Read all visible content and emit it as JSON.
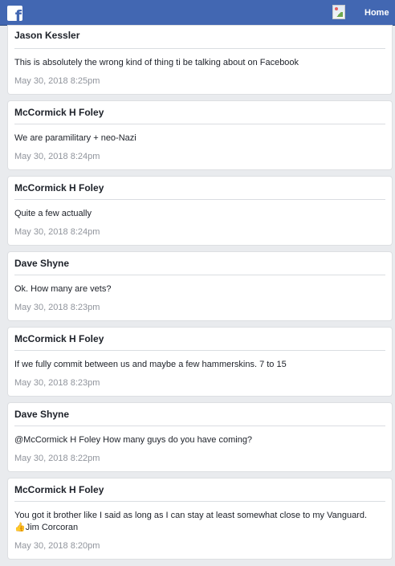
{
  "header": {
    "logo_letter": "f",
    "home_label": "Home"
  },
  "posts": [
    {
      "author": "Jason Kessler",
      "text": "This is absolutely the wrong kind of thing ti be talking about on Facebook",
      "time": "May 30, 2018 8:25pm"
    },
    {
      "author": "McCormick H Foley",
      "text": "We are paramilitary + neo-Nazi",
      "time": "May 30, 2018 8:24pm"
    },
    {
      "author": "McCormick H Foley",
      "text": "Quite a few actually",
      "time": "May 30, 2018 8:24pm"
    },
    {
      "author": "Dave Shyne",
      "text": "Ok. How many are vets?",
      "time": "May 30, 2018 8:23pm"
    },
    {
      "author": "McCormick H Foley",
      "text": "If we fully commit between us and maybe a few hammerskins. 7 to 15",
      "time": "May 30, 2018 8:23pm"
    },
    {
      "author": "Dave Shyne",
      "text": "@McCormick H Foley How many guys do you have coming?",
      "time": "May 30, 2018 8:22pm"
    },
    {
      "author": "McCormick H Foley",
      "text": "You got it brother like I said as long as I can stay at least somewhat close to my Vanguard.",
      "reaction": "👍Jim Corcoran",
      "time": "May 30, 2018 8:20pm"
    }
  ]
}
